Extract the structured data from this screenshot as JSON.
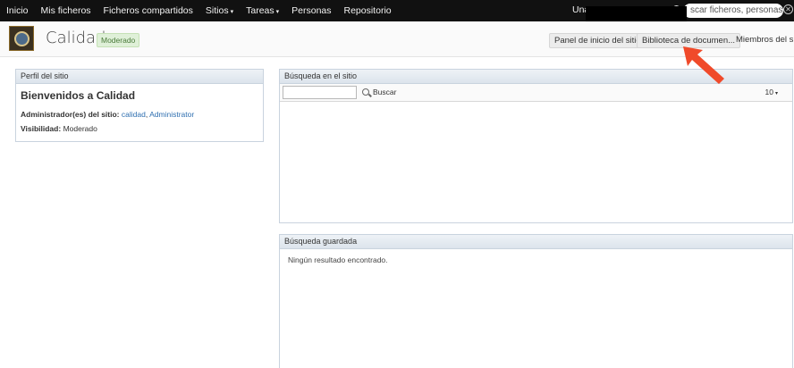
{
  "topnav": {
    "items": [
      {
        "label": "Inicio",
        "caret": false
      },
      {
        "label": "Mis ficheros",
        "caret": false
      },
      {
        "label": "Ficheros compartidos",
        "caret": false
      },
      {
        "label": "Sitios",
        "caret": true
      },
      {
        "label": "Tareas",
        "caret": true
      },
      {
        "label": "Personas",
        "caret": false
      },
      {
        "label": "Repositorio",
        "caret": false
      }
    ],
    "user_label": "Una",
    "search_placeholder": "scar ficheros, personas, siti",
    "caret_glyph": "▾",
    "clear_glyph": "✕"
  },
  "site": {
    "title": "Calidad",
    "badge": "Moderado",
    "buttons": {
      "dashboard": "Panel de inicio del sitio",
      "library": "Biblioteca de documen...",
      "members": "Miembros del siti"
    }
  },
  "profile": {
    "title": "Perfil del sitio",
    "welcome": "Bienvenidos a Calidad",
    "admins_label": "Administrador(es) del sitio:",
    "admins": [
      "calidad",
      "Administrator"
    ],
    "admins_sep": ",",
    "visibility_label": "Visibilidad:",
    "visibility_value": "Moderado"
  },
  "site_search": {
    "title": "Búsqueda en el sitio",
    "button_label": "Buscar",
    "page_size": "10",
    "caret_glyph": "▾"
  },
  "saved_search": {
    "title": "Búsqueda guardada",
    "empty_text": "Ningún resultado encontrado."
  },
  "colors": {
    "topbar": "#111111",
    "link": "#2f6fb0",
    "badge_bg": "#dff0d8",
    "annotation_arrow": "#f04a2a"
  }
}
